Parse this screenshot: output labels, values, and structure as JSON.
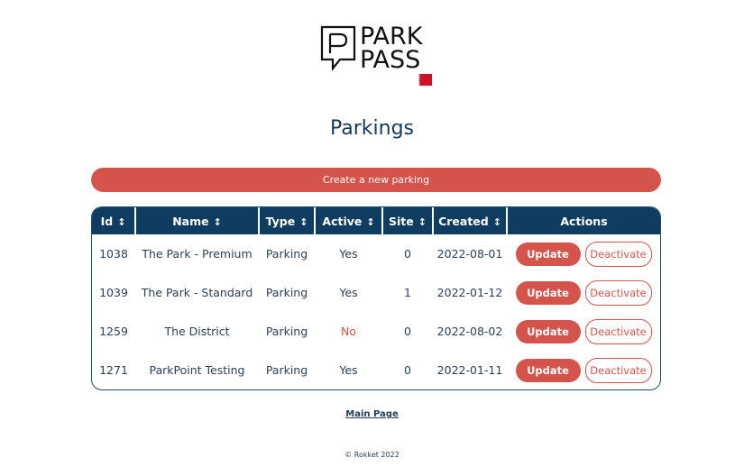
{
  "brand": {
    "logo_line1": "PARK",
    "logo_line2": "PASS",
    "flag_icon": "bahrain-flag-icon"
  },
  "page_title": "Parkings",
  "create_button": "Create a new parking",
  "table": {
    "columns": [
      {
        "label": "Id",
        "sortable": true
      },
      {
        "label": "Name",
        "sortable": true
      },
      {
        "label": "Type",
        "sortable": true
      },
      {
        "label": "Active",
        "sortable": true
      },
      {
        "label": "Site",
        "sortable": true
      },
      {
        "label": "Created",
        "sortable": true
      },
      {
        "label": "Actions",
        "sortable": false
      }
    ],
    "sort_icon": "↕",
    "rows": [
      {
        "id": "1038",
        "name": "The Park - Premium",
        "type": "Parking",
        "active": "Yes",
        "site": "0",
        "created": "2022-08-01",
        "update": "Update",
        "deactivate": "Deactivate"
      },
      {
        "id": "1039",
        "name": "The Park - Standard",
        "type": "Parking",
        "active": "Yes",
        "site": "1",
        "created": "2022-01-12",
        "update": "Update",
        "deactivate": "Deactivate"
      },
      {
        "id": "1259",
        "name": "The District",
        "type": "Parking",
        "active": "No",
        "site": "0",
        "created": "2022-08-02",
        "update": "Update",
        "deactivate": "Deactivate"
      },
      {
        "id": "1271",
        "name": "ParkPoint Testing",
        "type": "Parking",
        "active": "Yes",
        "site": "0",
        "created": "2022-01-11",
        "update": "Update",
        "deactivate": "Deactivate"
      }
    ]
  },
  "main_page_link": "Main Page",
  "footer": "© Rokket 2022",
  "colors": {
    "primary": "#0f3d62",
    "accent": "#d4544b"
  }
}
